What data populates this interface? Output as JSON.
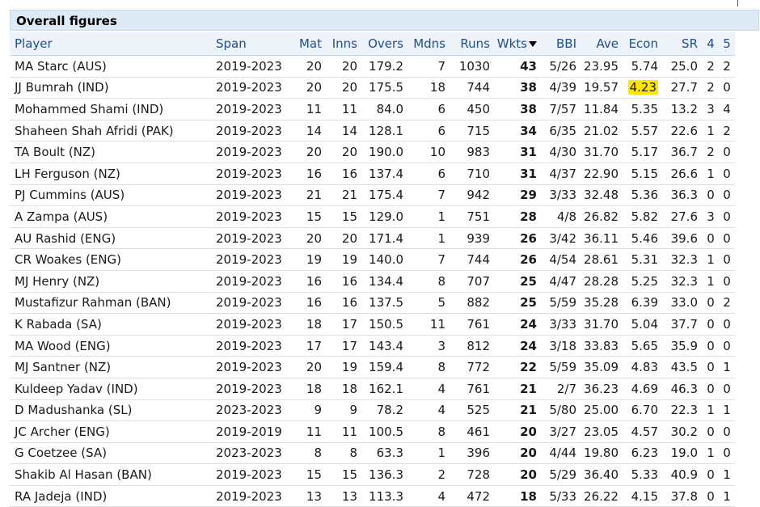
{
  "title": "Overall figures",
  "columns": [
    {
      "key": "player",
      "label": "Player"
    },
    {
      "key": "span",
      "label": "Span"
    },
    {
      "key": "mat",
      "label": "Mat"
    },
    {
      "key": "inns",
      "label": "Inns"
    },
    {
      "key": "overs",
      "label": "Overs"
    },
    {
      "key": "mdns",
      "label": "Mdns"
    },
    {
      "key": "runs",
      "label": "Runs"
    },
    {
      "key": "wkts",
      "label": "Wkts"
    },
    {
      "key": "bbi",
      "label": "BBI"
    },
    {
      "key": "ave",
      "label": "Ave"
    },
    {
      "key": "econ",
      "label": "Econ"
    },
    {
      "key": "sr",
      "label": "SR"
    },
    {
      "key": "four",
      "label": "4"
    },
    {
      "key": "five",
      "label": "5"
    }
  ],
  "rows": [
    [
      "MA Starc (AUS)",
      "2019-2023",
      "20",
      "20",
      "179.2",
      "7",
      "1030",
      "43",
      "5/26",
      "23.95",
      "5.74",
      "25.0",
      "2",
      "2"
    ],
    [
      "JJ Bumrah (IND)",
      "2019-2023",
      "20",
      "20",
      "175.5",
      "18",
      "744",
      "38",
      "4/39",
      "19.57",
      "4.23",
      "27.7",
      "2",
      "0"
    ],
    [
      "Mohammed Shami (IND)",
      "2019-2023",
      "11",
      "11",
      "84.0",
      "6",
      "450",
      "38",
      "7/57",
      "11.84",
      "5.35",
      "13.2",
      "3",
      "4"
    ],
    [
      "Shaheen Shah Afridi (PAK)",
      "2019-2023",
      "14",
      "14",
      "128.1",
      "6",
      "715",
      "34",
      "6/35",
      "21.02",
      "5.57",
      "22.6",
      "1",
      "2"
    ],
    [
      "TA Boult (NZ)",
      "2019-2023",
      "20",
      "20",
      "190.0",
      "10",
      "983",
      "31",
      "4/30",
      "31.70",
      "5.17",
      "36.7",
      "2",
      "0"
    ],
    [
      "LH Ferguson (NZ)",
      "2019-2023",
      "16",
      "16",
      "137.4",
      "6",
      "710",
      "31",
      "4/37",
      "22.90",
      "5.15",
      "26.6",
      "1",
      "0"
    ],
    [
      "PJ Cummins (AUS)",
      "2019-2023",
      "21",
      "21",
      "175.4",
      "7",
      "942",
      "29",
      "3/33",
      "32.48",
      "5.36",
      "36.3",
      "0",
      "0"
    ],
    [
      "A Zampa (AUS)",
      "2019-2023",
      "15",
      "15",
      "129.0",
      "1",
      "751",
      "28",
      "4/8",
      "26.82",
      "5.82",
      "27.6",
      "3",
      "0"
    ],
    [
      "AU Rashid (ENG)",
      "2019-2023",
      "20",
      "20",
      "171.4",
      "1",
      "939",
      "26",
      "3/42",
      "36.11",
      "5.46",
      "39.6",
      "0",
      "0"
    ],
    [
      "CR Woakes (ENG)",
      "2019-2023",
      "19",
      "19",
      "140.0",
      "7",
      "744",
      "26",
      "4/54",
      "28.61",
      "5.31",
      "32.3",
      "1",
      "0"
    ],
    [
      "MJ Henry (NZ)",
      "2019-2023",
      "16",
      "16",
      "134.4",
      "8",
      "707",
      "25",
      "4/47",
      "28.28",
      "5.25",
      "32.3",
      "1",
      "0"
    ],
    [
      "Mustafizur Rahman (BAN)",
      "2019-2023",
      "16",
      "16",
      "137.5",
      "5",
      "882",
      "25",
      "5/59",
      "35.28",
      "6.39",
      "33.0",
      "0",
      "2"
    ],
    [
      "K Rabada (SA)",
      "2019-2023",
      "18",
      "17",
      "150.5",
      "11",
      "761",
      "24",
      "3/33",
      "31.70",
      "5.04",
      "37.7",
      "0",
      "0"
    ],
    [
      "MA Wood (ENG)",
      "2019-2023",
      "17",
      "17",
      "143.4",
      "3",
      "812",
      "24",
      "3/18",
      "33.83",
      "5.65",
      "35.9",
      "0",
      "0"
    ],
    [
      "MJ Santner (NZ)",
      "2019-2023",
      "20",
      "19",
      "159.4",
      "8",
      "772",
      "22",
      "5/59",
      "35.09",
      "4.83",
      "43.5",
      "0",
      "1"
    ],
    [
      "Kuldeep Yadav (IND)",
      "2019-2023",
      "18",
      "18",
      "162.1",
      "4",
      "761",
      "21",
      "2/7",
      "36.23",
      "4.69",
      "46.3",
      "0",
      "0"
    ],
    [
      "D Madushanka (SL)",
      "2023-2023",
      "9",
      "9",
      "78.2",
      "4",
      "525",
      "21",
      "5/80",
      "25.00",
      "6.70",
      "22.3",
      "1",
      "1"
    ],
    [
      "JC Archer (ENG)",
      "2019-2019",
      "11",
      "11",
      "100.5",
      "8",
      "461",
      "20",
      "3/27",
      "23.05",
      "4.57",
      "30.2",
      "0",
      "0"
    ],
    [
      "G Coetzee (SA)",
      "2023-2023",
      "8",
      "8",
      "63.3",
      "1",
      "396",
      "20",
      "4/44",
      "19.80",
      "6.23",
      "19.0",
      "1",
      "0"
    ],
    [
      "Shakib Al Hasan (BAN)",
      "2019-2023",
      "15",
      "15",
      "136.3",
      "2",
      "728",
      "20",
      "5/29",
      "36.40",
      "5.33",
      "40.9",
      "0",
      "1"
    ],
    [
      "RA Jadeja (IND)",
      "2019-2023",
      "13",
      "13",
      "113.3",
      "4",
      "472",
      "18",
      "5/33",
      "26.22",
      "4.15",
      "37.8",
      "0",
      "1"
    ]
  ],
  "highlight": {
    "row": 1,
    "col": 10,
    "color": "#ffe600"
  },
  "sorted_column": "wkts",
  "sort_icon": "sort-desc-icon",
  "colors": {
    "header_text": "#1f4f8c",
    "title_bg": "#dfeaf7",
    "header_bg": "#eef3fa"
  }
}
